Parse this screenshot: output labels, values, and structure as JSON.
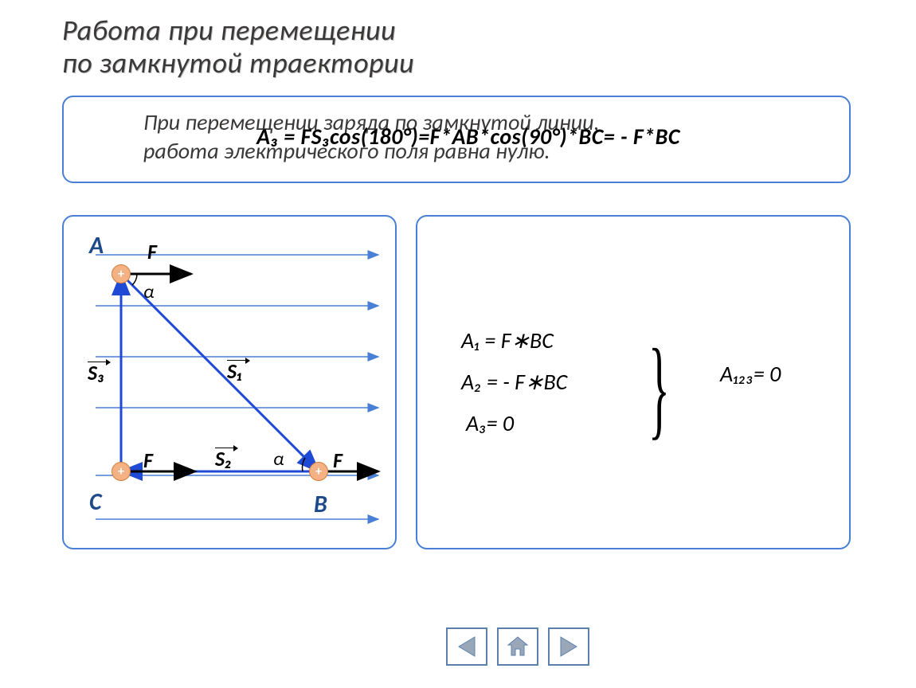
{
  "title_line1": "Работа при перемещении",
  "title_line2": "по замкнутой траектории",
  "top_text_line1": "При перемещении заряда по замкнутой линии,",
  "top_text_line2": "работа электрического поля равна нулю.",
  "formula_overlay": "A₃ = FS₃cos(180°)=F*AB*cos(90°)*BC= - F*BC",
  "diagram": {
    "A": "A",
    "B": "B",
    "C": "C",
    "F": "F",
    "S1": "S₁",
    "S2": "S₂",
    "S3": "S₃",
    "alpha": "α",
    "plus": "+"
  },
  "equations": {
    "a1": "A₁ = F∗BC",
    "a2": "A₂ = - F∗BC",
    "a3": "A₃= 0",
    "result": "A₁₂₃= 0"
  },
  "nav": {
    "prev": "prev",
    "home": "home",
    "next": "next"
  }
}
